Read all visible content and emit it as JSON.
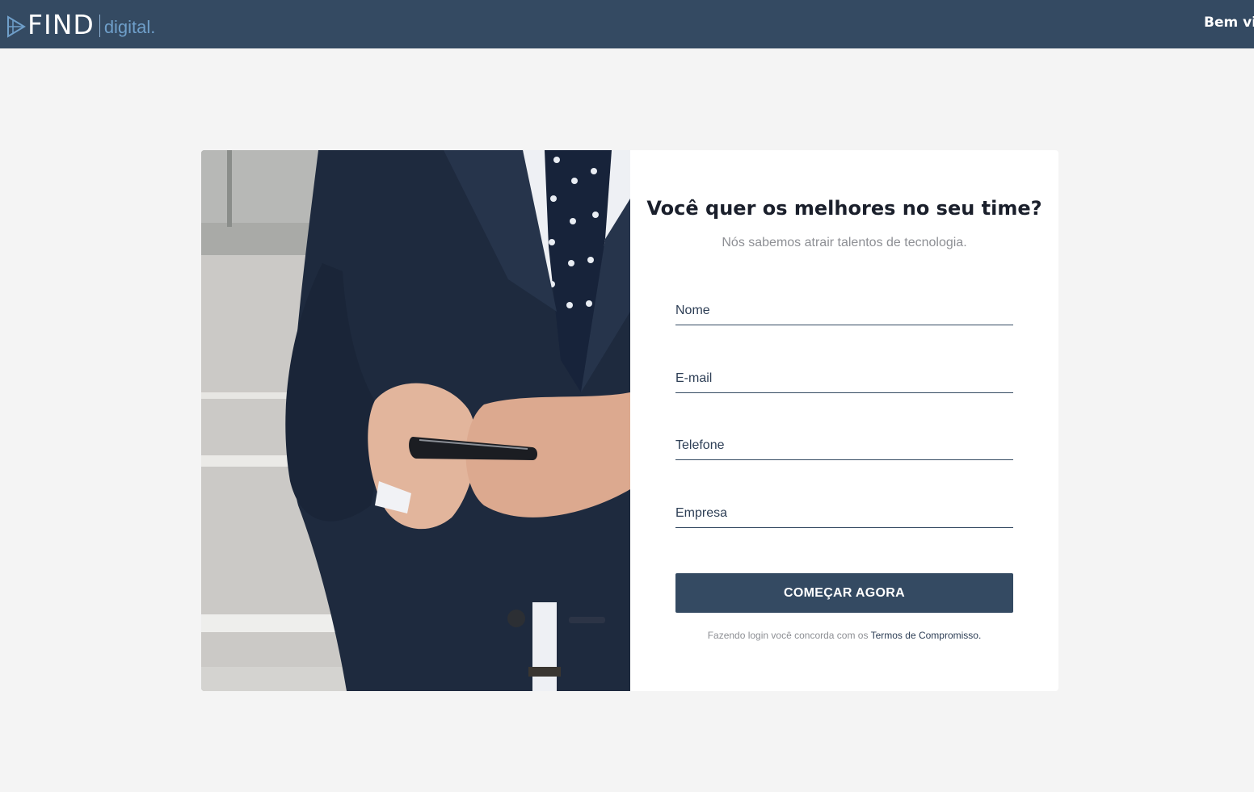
{
  "header": {
    "logo_find": "FIND",
    "logo_digital": "digital.",
    "welcome_text": "Bem vindo"
  },
  "hero": {
    "headline": "Você quer os melhores no seu time?",
    "subline": "Nós sabemos atrair talentos de tecnologia."
  },
  "form": {
    "name_placeholder": "Nome",
    "email_placeholder": "E-mail",
    "phone_placeholder": "Telefone",
    "company_placeholder": "Empresa",
    "submit_label": "COMEÇAR AGORA",
    "terms_prefix": "Fazendo login você concorda com os ",
    "terms_link": "Termos de Compromisso."
  },
  "colors": {
    "header_bg": "#344a62",
    "accent": "#344a62",
    "page_bg": "#f4f4f4",
    "logo_digital": "#6f9fca"
  },
  "icons": {
    "logo_mark": "triangle-arrow-logo-icon"
  }
}
